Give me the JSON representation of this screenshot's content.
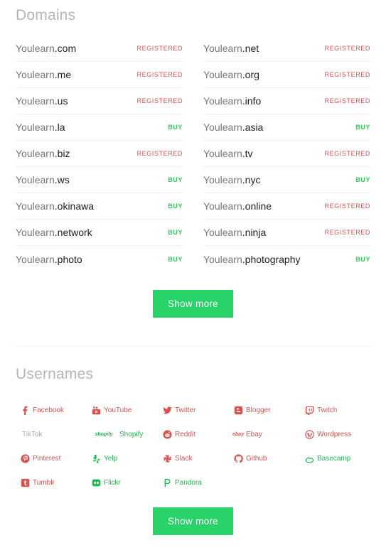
{
  "domains": {
    "title": "Domains",
    "left": [
      {
        "base": "Youlearn",
        "tld": ".com",
        "status": "REGISTERED",
        "kind": "registered"
      },
      {
        "base": "Youlearn",
        "tld": ".me",
        "status": "REGISTERED",
        "kind": "registered"
      },
      {
        "base": "Youlearn",
        "tld": ".us",
        "status": "REGISTERED",
        "kind": "registered"
      },
      {
        "base": "Youlearn",
        "tld": ".la",
        "status": "BUY",
        "kind": "buy"
      },
      {
        "base": "Youlearn",
        "tld": ".biz",
        "status": "REGISTERED",
        "kind": "registered"
      },
      {
        "base": "Youlearn",
        "tld": ".ws",
        "status": "BUY",
        "kind": "buy"
      },
      {
        "base": "Youlearn",
        "tld": ".okinawa",
        "status": "BUY",
        "kind": "buy"
      },
      {
        "base": "Youlearn",
        "tld": ".network",
        "status": "BUY",
        "kind": "buy"
      },
      {
        "base": "Youlearn",
        "tld": ".photo",
        "status": "BUY",
        "kind": "buy"
      }
    ],
    "right": [
      {
        "base": "Youlearn",
        "tld": ".net",
        "status": "REGISTERED",
        "kind": "registered"
      },
      {
        "base": "Youlearn",
        "tld": ".org",
        "status": "REGISTERED",
        "kind": "registered"
      },
      {
        "base": "Youlearn",
        "tld": ".info",
        "status": "REGISTERED",
        "kind": "registered"
      },
      {
        "base": "Youlearn",
        "tld": ".asia",
        "status": "BUY",
        "kind": "buy"
      },
      {
        "base": "Youlearn",
        "tld": ".tv",
        "status": "REGISTERED",
        "kind": "registered"
      },
      {
        "base": "Youlearn",
        "tld": ".nyc",
        "status": "BUY",
        "kind": "buy"
      },
      {
        "base": "Youlearn",
        "tld": ".online",
        "status": "REGISTERED",
        "kind": "registered"
      },
      {
        "base": "Youlearn",
        "tld": ".ninja",
        "status": "REGISTERED",
        "kind": "registered"
      },
      {
        "base": "Youlearn",
        "tld": ".photography",
        "status": "BUY",
        "kind": "buy"
      }
    ],
    "show_more_label": "Show more"
  },
  "usernames": {
    "title": "Usernames",
    "rows": [
      [
        {
          "label": "Facebook",
          "icon": "facebook-icon",
          "kind": "registered"
        },
        {
          "label": "YouTube",
          "icon": "youtube-icon",
          "kind": "registered"
        },
        {
          "label": "Twitter",
          "icon": "twitter-icon",
          "kind": "registered"
        },
        {
          "label": "Blogger",
          "icon": "blogger-icon",
          "kind": "registered"
        },
        {
          "label": "Twitch",
          "icon": "twitch-icon",
          "kind": "registered"
        }
      ],
      [
        {
          "label": "TikTok",
          "icon": "",
          "kind": "neutral"
        },
        {
          "label": "Shopify",
          "icon": "shopify-icon",
          "kind": "available",
          "icon_text": "shopify"
        },
        {
          "label": "Reddit",
          "icon": "reddit-icon",
          "kind": "registered"
        },
        {
          "label": "Ebay",
          "icon": "ebay-icon",
          "kind": "registered",
          "icon_text": "ebay"
        },
        {
          "label": "Wordpress",
          "icon": "wordpress-icon",
          "kind": "registered"
        }
      ],
      [
        {
          "label": "Pinterest",
          "icon": "pinterest-icon",
          "kind": "registered"
        },
        {
          "label": "Yelp",
          "icon": "yelp-icon",
          "kind": "available"
        },
        {
          "label": "Slack",
          "icon": "slack-icon",
          "kind": "registered"
        },
        {
          "label": "Github",
          "icon": "github-icon",
          "kind": "registered"
        },
        {
          "label": "Basecamp",
          "icon": "basecamp-icon",
          "kind": "available"
        }
      ],
      [
        {
          "label": "Tumblr",
          "icon": "tumblr-icon",
          "kind": "registered"
        },
        {
          "label": "Flickr",
          "icon": "flickr-icon",
          "kind": "available"
        },
        {
          "label": "Pandora",
          "icon": "pandora-icon",
          "kind": "available"
        }
      ]
    ],
    "show_more_label": "Show more"
  },
  "colors": {
    "registered": "#d9534f",
    "available": "#1fb851",
    "button": "#28d36a",
    "heading": "#b5b5b5"
  }
}
